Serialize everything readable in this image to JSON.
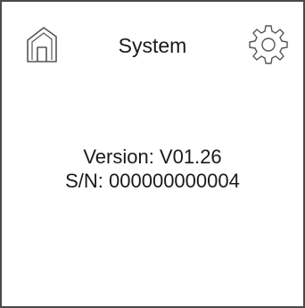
{
  "header": {
    "title": "System",
    "home_icon": "home-icon",
    "settings_icon": "gear-icon"
  },
  "info": {
    "version": "Version: V01.26",
    "serial": "S/N: 000000000004"
  },
  "colors": {
    "border": "#4a4a4a",
    "text": "#1a1a1a",
    "icon_stroke": "#555555",
    "background": "#ffffff"
  }
}
